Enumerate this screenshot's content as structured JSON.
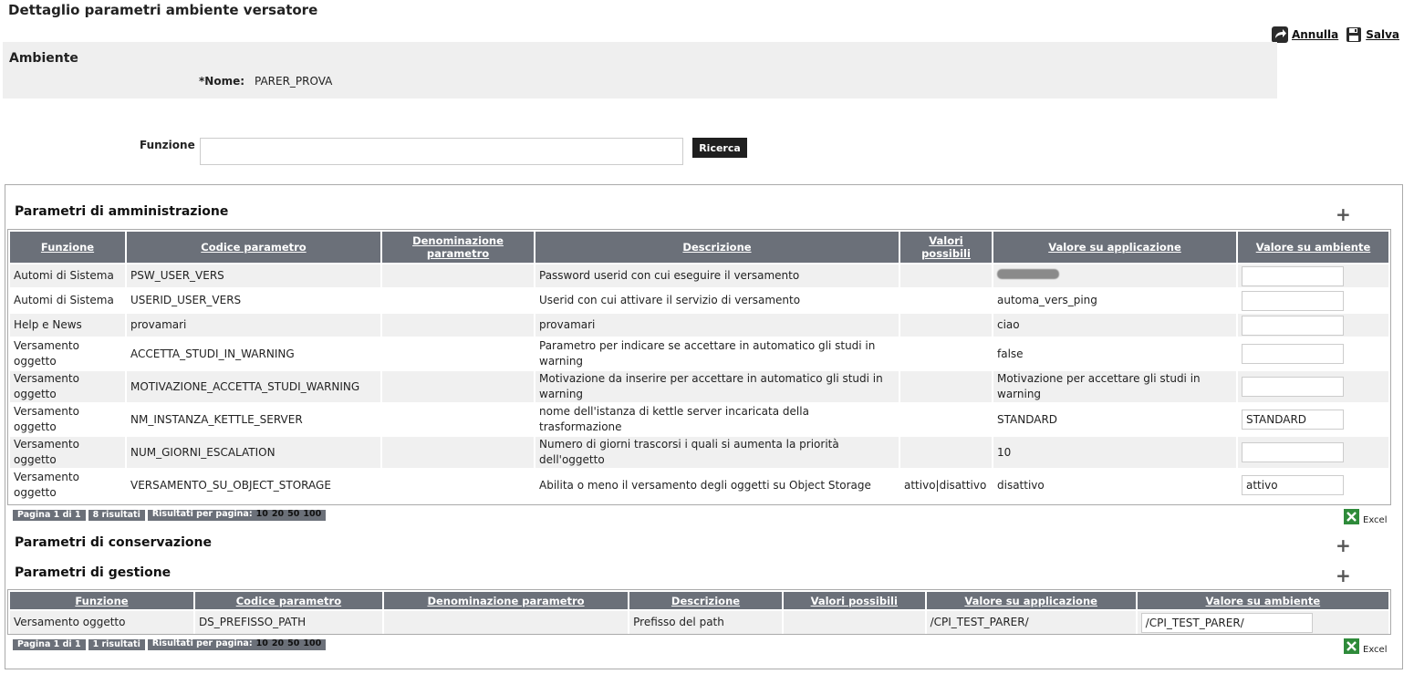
{
  "page": {
    "title": "Dettaglio parametri ambiente versatore"
  },
  "actions": {
    "cancel_label": "Annulla",
    "save_label": "Salva"
  },
  "ambiente": {
    "heading": "Ambiente",
    "name_label": "*Nome:",
    "name_value": "PARER_PROVA"
  },
  "search": {
    "label": "Funzione",
    "value": "",
    "button_label": "Ricerca"
  },
  "admin": {
    "title": "Parametri di amministrazione",
    "headers": [
      "Funzione",
      "Codice parametro",
      "Denominazione parametro",
      "Descrizione",
      "Valori possibili",
      "Valore su applicazione",
      "Valore su ambiente"
    ],
    "rows": [
      {
        "funzione": "Automi di Sistema",
        "codice": "PSW_USER_VERS",
        "denominazione": "",
        "descrizione": "Password userid con cui eseguire il versamento",
        "valori": "",
        "applicazione": "",
        "ambiente": "",
        "redacted": true
      },
      {
        "funzione": "Automi di Sistema",
        "codice": "USERID_USER_VERS",
        "denominazione": "",
        "descrizione": "Userid con cui attivare il servizio di versamento",
        "valori": "",
        "applicazione": "automa_vers_ping",
        "ambiente": ""
      },
      {
        "funzione": "Help e News",
        "codice": "provamari",
        "denominazione": "",
        "descrizione": "provamari",
        "valori": "",
        "applicazione": "ciao",
        "ambiente": ""
      },
      {
        "funzione": "Versamento oggetto",
        "codice": "ACCETTA_STUDI_IN_WARNING",
        "denominazione": "",
        "descrizione": "Parametro per indicare se accettare in automatico gli studi in warning",
        "valori": "",
        "applicazione": "false",
        "ambiente": ""
      },
      {
        "funzione": "Versamento oggetto",
        "codice": "MOTIVAZIONE_ACCETTA_STUDI_WARNING",
        "denominazione": "",
        "descrizione": "Motivazione da inserire per accettare in automatico gli studi in warning",
        "valori": "",
        "applicazione": "Motivazione per accettare gli studi in warning",
        "ambiente": ""
      },
      {
        "funzione": "Versamento oggetto",
        "codice": "NM_INSTANZA_KETTLE_SERVER",
        "denominazione": "",
        "descrizione": "nome dell'istanza di kettle server incaricata della trasformazione",
        "valori": "",
        "applicazione": "STANDARD",
        "ambiente": "STANDARD"
      },
      {
        "funzione": "Versamento oggetto",
        "codice": "NUM_GIORNI_ESCALATION",
        "denominazione": "",
        "descrizione": "Numero di giorni trascorsi i quali si aumenta la priorità dell'oggetto",
        "valori": "",
        "applicazione": "10",
        "ambiente": ""
      },
      {
        "funzione": "Versamento oggetto",
        "codice": "VERSAMENTO_SU_OBJECT_STORAGE",
        "denominazione": "",
        "descrizione": "Abilita o meno il versamento degli oggetti su Object Storage",
        "valori": "attivo|disattivo",
        "applicazione": "disattivo",
        "ambiente": "attivo"
      }
    ],
    "pager": {
      "page": "Pagina 1 di 1",
      "results": "8 risultati",
      "per_page": "Risultati per pagina:",
      "sizes": [
        "10",
        "20",
        "50",
        "100"
      ]
    },
    "excel": "Excel"
  },
  "conservazione": {
    "title": "Parametri di conservazione"
  },
  "gestione": {
    "title": "Parametri di gestione",
    "headers": [
      "Funzione",
      "Codice parametro",
      "Denominazione parametro",
      "Descrizione",
      "Valori possibili",
      "Valore su applicazione",
      "Valore su ambiente"
    ],
    "rows": [
      {
        "funzione": "Versamento oggetto",
        "codice": "DS_PREFISSO_PATH",
        "denominazione": "",
        "descrizione": "Prefisso del path",
        "valori": "",
        "applicazione": "/CPI_TEST_PARER/",
        "ambiente": "/CPI_TEST_PARER/"
      }
    ],
    "pager": {
      "page": "Pagina 1 di 1",
      "results": "1 risultati",
      "per_page": "Risultati per pagina:",
      "sizes": [
        "10",
        "20",
        "50",
        "100"
      ]
    },
    "excel": "Excel"
  },
  "colors": {
    "header_bg": "#6b7079",
    "row_alt": "#f0f0f0",
    "button_bg": "#1f1f1f"
  },
  "icons": {
    "cancel": "undo-arrow-icon",
    "save": "floppy-disk-icon",
    "add": "plus-icon",
    "excel": "excel-icon"
  }
}
